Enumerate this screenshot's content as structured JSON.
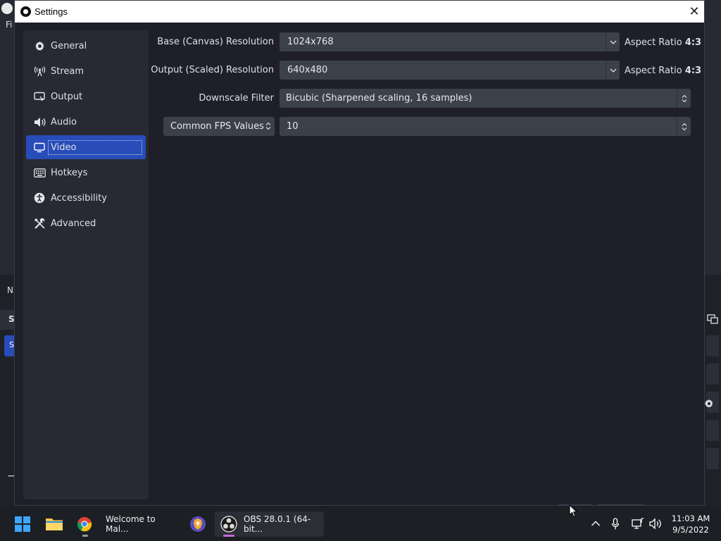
{
  "background": {
    "menu_letters": "Fi",
    "left_letter_n": "N",
    "left_letter_s": "S",
    "left_selected_letter": "S",
    "left_minus": "−"
  },
  "dialog": {
    "title": "Settings",
    "close_glyph": "✕"
  },
  "sidebar": {
    "items": [
      {
        "label": "General",
        "icon": "gear-icon"
      },
      {
        "label": "Stream",
        "icon": "antenna-icon"
      },
      {
        "label": "Output",
        "icon": "output-icon"
      },
      {
        "label": "Audio",
        "icon": "speaker-icon"
      },
      {
        "label": "Video",
        "icon": "monitor-icon",
        "active": true
      },
      {
        "label": "Hotkeys",
        "icon": "keyboard-icon"
      },
      {
        "label": "Accessibility",
        "icon": "accessibility-icon"
      },
      {
        "label": "Advanced",
        "icon": "tools-icon"
      }
    ]
  },
  "video": {
    "base_resolution": {
      "label": "Base (Canvas) Resolution",
      "value": "1024x768",
      "aspect_prefix": "Aspect Ratio",
      "aspect_value": "4:3"
    },
    "output_resolution": {
      "label": "Output (Scaled) Resolution",
      "value": "640x480",
      "aspect_prefix": "Aspect Ratio",
      "aspect_value": "4:3"
    },
    "downscale_filter": {
      "label": "Downscale Filter",
      "value": "Bicubic (Sharpened scaling, 16 samples)"
    },
    "fps": {
      "type_value": "Common FPS Values",
      "value": "10"
    }
  },
  "taskbar": {
    "chrome_label": "Welcome to Mal...",
    "obs_label": "OBS 28.0.1 (64-bit...",
    "time": "11:03 AM",
    "date": "9/5/2022"
  },
  "colors": {
    "accent": "#284cb8",
    "dialog_bg": "#1e1f29",
    "panel_bg": "#272a33",
    "field_bg": "#3c404b"
  }
}
